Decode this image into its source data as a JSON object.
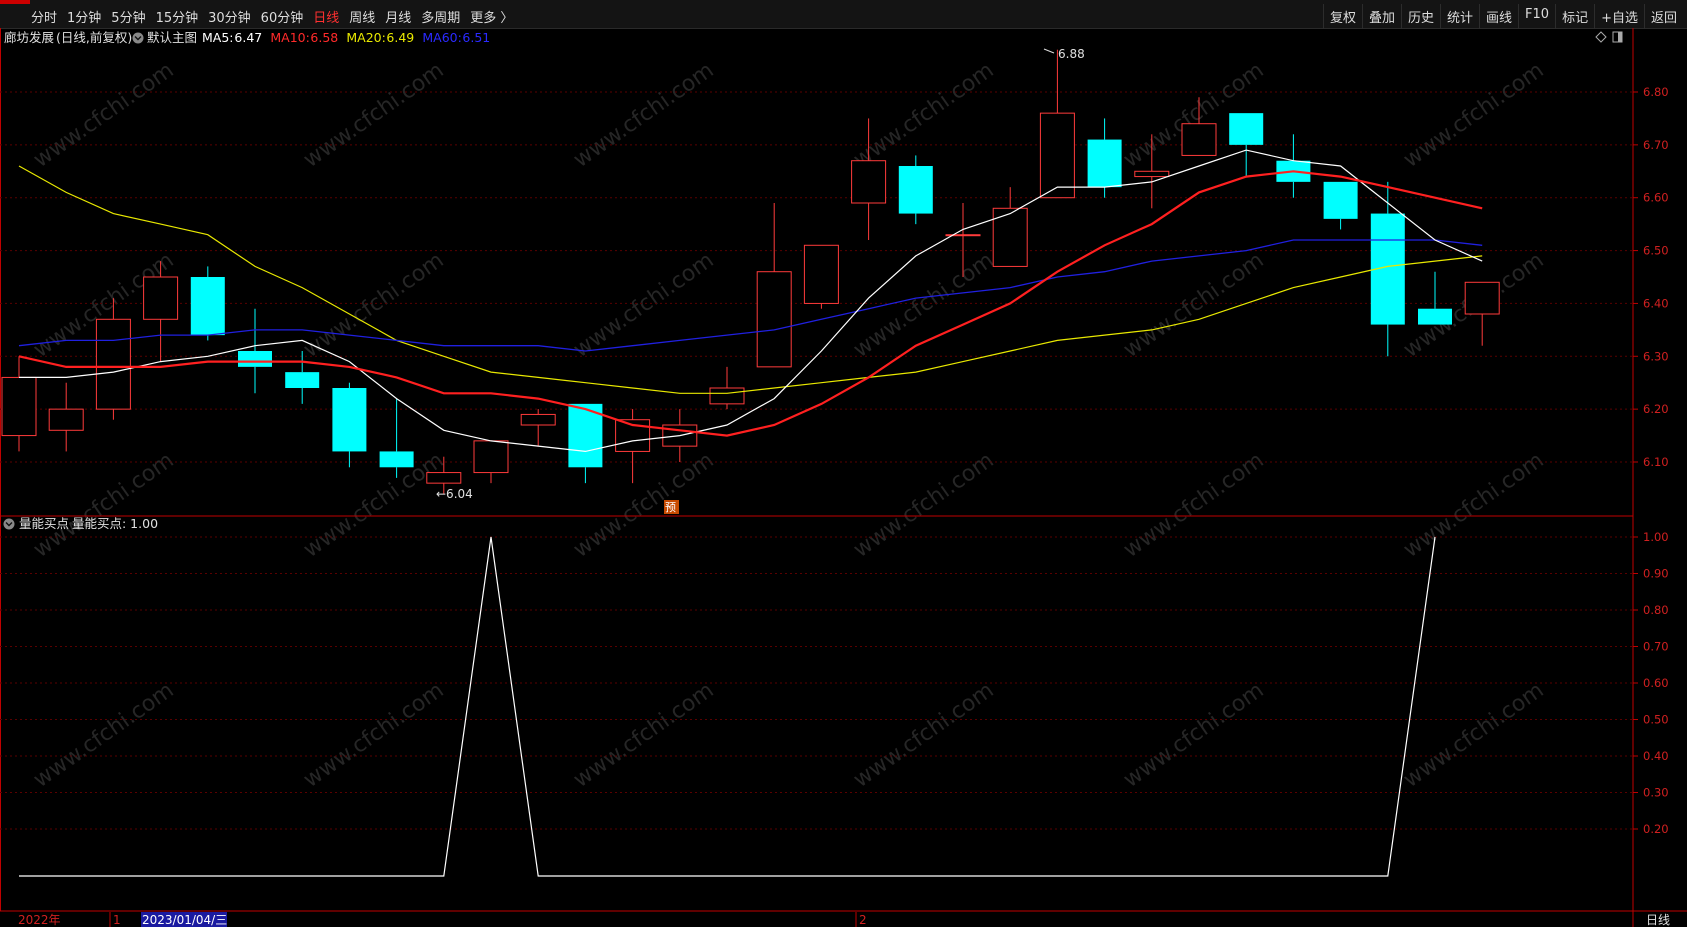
{
  "toolbar": {
    "periods": [
      "分时",
      "1分钟",
      "5分钟",
      "15分钟",
      "30分钟",
      "60分钟",
      "日线",
      "周线",
      "月线",
      "多周期",
      "更多 〉"
    ],
    "active_period": "日线",
    "tools": [
      "复权",
      "叠加",
      "历史",
      "统计",
      "画线",
      "F10",
      "标记",
      "+自选",
      "返回"
    ]
  },
  "main_panel": {
    "stock_name": "廊坊发展",
    "mode": "(日线,前复权)",
    "template": "默认主图",
    "ma": [
      {
        "label": "MA5:",
        "value": "6.47",
        "color": "#ffffff"
      },
      {
        "label": "MA10:",
        "value": "6.58",
        "color": "#ff2a2a"
      },
      {
        "label": "MA20:",
        "value": "6.49",
        "color": "#e8e800"
      },
      {
        "label": "MA60:",
        "value": "6.51",
        "color": "#2a2aff"
      }
    ],
    "high_mark": "6.88",
    "low_mark": "←6.04",
    "pre_badge": "预",
    "y_ticks": [
      "6.80",
      "6.70",
      "6.60",
      "6.50",
      "6.40",
      "6.30",
      "6.20",
      "6.10"
    ]
  },
  "sub_panel": {
    "indicator_name": "量能买点",
    "readout": "量能买点: 1.00",
    "y_ticks": [
      "1.00",
      "0.90",
      "0.80",
      "0.70",
      "0.60",
      "0.50",
      "0.40",
      "0.30",
      "0.20"
    ]
  },
  "bottom_axis": {
    "year": "2022年",
    "month1": "1",
    "cursor_date": "2023/01/04/三",
    "month2": "2",
    "period_label": "日线"
  },
  "watermark": "www.cfchi.com",
  "colors": {
    "up": "#ff3b3b",
    "down": "#00ffff",
    "ma5": "#ffffff",
    "ma10": "#ff2020",
    "ma20": "#e8e800",
    "ma60": "#2020e0",
    "grid": "#5a0000",
    "axis": "#c00000"
  },
  "chart_data": {
    "type": "candlestick",
    "price_ylim": [
      6.0,
      6.9
    ],
    "candles": [
      {
        "o": 6.15,
        "h": 6.3,
        "l": 6.12,
        "c": 6.26
      },
      {
        "o": 6.16,
        "h": 6.25,
        "l": 6.12,
        "c": 6.2
      },
      {
        "o": 6.2,
        "h": 6.41,
        "l": 6.18,
        "c": 6.37
      },
      {
        "o": 6.37,
        "h": 6.48,
        "l": 6.29,
        "c": 6.45
      },
      {
        "o": 6.45,
        "h": 6.47,
        "l": 6.33,
        "c": 6.34
      },
      {
        "o": 6.31,
        "h": 6.39,
        "l": 6.23,
        "c": 6.28
      },
      {
        "o": 6.27,
        "h": 6.31,
        "l": 6.21,
        "c": 6.24
      },
      {
        "o": 6.24,
        "h": 6.25,
        "l": 6.09,
        "c": 6.12
      },
      {
        "o": 6.12,
        "h": 6.22,
        "l": 6.07,
        "c": 6.09
      },
      {
        "o": 6.06,
        "h": 6.11,
        "l": 6.04,
        "c": 6.08
      },
      {
        "o": 6.08,
        "h": 6.14,
        "l": 6.06,
        "c": 6.14
      },
      {
        "o": 6.17,
        "h": 6.2,
        "l": 6.13,
        "c": 6.19
      },
      {
        "o": 6.21,
        "h": 6.21,
        "l": 6.06,
        "c": 6.09
      },
      {
        "o": 6.12,
        "h": 6.2,
        "l": 6.06,
        "c": 6.18
      },
      {
        "o": 6.13,
        "h": 6.2,
        "l": 6.1,
        "c": 6.17
      },
      {
        "o": 6.21,
        "h": 6.28,
        "l": 6.2,
        "c": 6.24
      },
      {
        "o": 6.28,
        "h": 6.59,
        "l": 6.28,
        "c": 6.46
      },
      {
        "o": 6.4,
        "h": 6.51,
        "l": 6.39,
        "c": 6.51
      },
      {
        "o": 6.59,
        "h": 6.75,
        "l": 6.52,
        "c": 6.67
      },
      {
        "o": 6.66,
        "h": 6.68,
        "l": 6.55,
        "c": 6.57
      },
      {
        "o": 6.53,
        "h": 6.59,
        "l": 6.45,
        "c": 6.53
      },
      {
        "o": 6.47,
        "h": 6.62,
        "l": 6.47,
        "c": 6.58
      },
      {
        "o": 6.6,
        "h": 6.88,
        "l": 6.6,
        "c": 6.76
      },
      {
        "o": 6.71,
        "h": 6.75,
        "l": 6.6,
        "c": 6.62
      },
      {
        "o": 6.64,
        "h": 6.72,
        "l": 6.58,
        "c": 6.65
      },
      {
        "o": 6.68,
        "h": 6.79,
        "l": 6.68,
        "c": 6.74
      },
      {
        "o": 6.76,
        "h": 6.76,
        "l": 6.64,
        "c": 6.7
      },
      {
        "o": 6.67,
        "h": 6.72,
        "l": 6.6,
        "c": 6.63
      },
      {
        "o": 6.63,
        "h": 6.63,
        "l": 6.54,
        "c": 6.56
      },
      {
        "o": 6.57,
        "h": 6.63,
        "l": 6.3,
        "c": 6.36
      },
      {
        "o": 6.39,
        "h": 6.46,
        "l": 6.36,
        "c": 6.36
      },
      {
        "o": 6.38,
        "h": 6.44,
        "l": 6.32,
        "c": 6.44
      }
    ],
    "ma5": [
      6.26,
      6.26,
      6.27,
      6.29,
      6.3,
      6.32,
      6.33,
      6.29,
      6.22,
      6.16,
      6.14,
      6.13,
      6.12,
      6.14,
      6.15,
      6.17,
      6.22,
      6.31,
      6.41,
      6.49,
      6.54,
      6.57,
      6.62,
      6.62,
      6.63,
      6.66,
      6.69,
      6.67,
      6.66,
      6.59,
      6.52,
      6.48
    ],
    "ma10": [
      6.3,
      6.28,
      6.28,
      6.28,
      6.29,
      6.29,
      6.29,
      6.28,
      6.26,
      6.23,
      6.23,
      6.22,
      6.2,
      6.17,
      6.16,
      6.15,
      6.17,
      6.21,
      6.26,
      6.32,
      6.36,
      6.4,
      6.46,
      6.51,
      6.55,
      6.61,
      6.64,
      6.65,
      6.64,
      6.62,
      6.6,
      6.58
    ],
    "ma20": [
      6.66,
      6.61,
      6.57,
      6.55,
      6.53,
      6.47,
      6.43,
      6.38,
      6.33,
      6.3,
      6.27,
      6.26,
      6.25,
      6.24,
      6.23,
      6.23,
      6.24,
      6.25,
      6.26,
      6.27,
      6.29,
      6.31,
      6.33,
      6.34,
      6.35,
      6.37,
      6.4,
      6.43,
      6.45,
      6.47,
      6.48,
      6.49
    ],
    "ma60": [
      6.32,
      6.33,
      6.33,
      6.34,
      6.34,
      6.35,
      6.35,
      6.34,
      6.33,
      6.32,
      6.32,
      6.32,
      6.31,
      6.32,
      6.33,
      6.34,
      6.35,
      6.37,
      6.39,
      6.41,
      6.42,
      6.43,
      6.45,
      6.46,
      6.48,
      6.49,
      6.5,
      6.52,
      6.52,
      6.52,
      6.52,
      6.51
    ],
    "indicator_ylim": [
      0,
      1.0
    ],
    "indicator_values": [
      0,
      0,
      0,
      0,
      0,
      0,
      0,
      0,
      0,
      0,
      1,
      0,
      0,
      0,
      0,
      0,
      0,
      0,
      0,
      0,
      0,
      0,
      0,
      0,
      0,
      0,
      0,
      0,
      0,
      0,
      1
    ]
  }
}
